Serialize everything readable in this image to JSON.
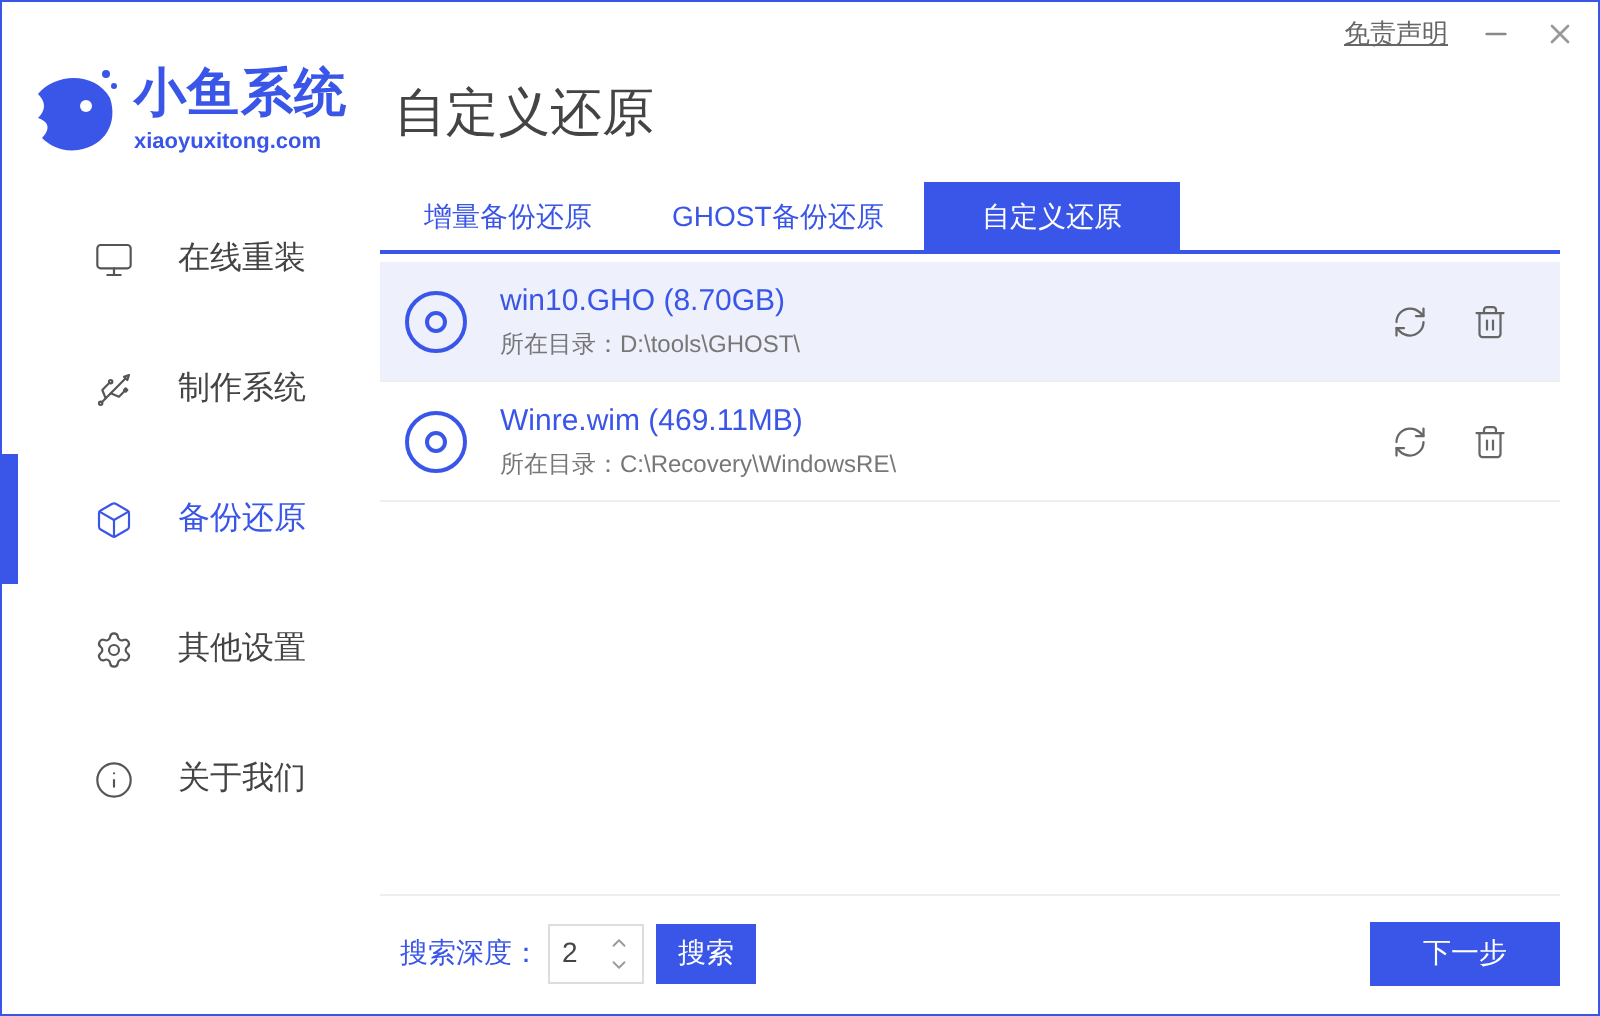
{
  "brand": {
    "name": "小鱼系统",
    "domain": "xiaoyuxitong.com"
  },
  "header": {
    "title": "自定义还原",
    "disclaimer": "免责声明"
  },
  "sidebar": {
    "items": [
      {
        "label": "在线重装",
        "selected": false
      },
      {
        "label": "制作系统",
        "selected": false
      },
      {
        "label": "备份还原",
        "selected": true
      },
      {
        "label": "其他设置",
        "selected": false
      },
      {
        "label": "关于我们",
        "selected": false
      }
    ]
  },
  "tabs": [
    {
      "label": "增量备份还原",
      "selected": false
    },
    {
      "label": "GHOST备份还原",
      "selected": false
    },
    {
      "label": "自定义还原",
      "selected": true
    }
  ],
  "files": [
    {
      "name": "win10.GHO (8.70GB)",
      "path": "所在目录：D:\\tools\\GHOST\\",
      "selected": true
    },
    {
      "name": "Winre.wim (469.11MB)",
      "path": "所在目录：C:\\Recovery\\WindowsRE\\",
      "selected": false
    }
  ],
  "footer": {
    "depth_label": "搜索深度：",
    "depth_value": "2",
    "search_button": "搜索",
    "next_button": "下一步"
  }
}
